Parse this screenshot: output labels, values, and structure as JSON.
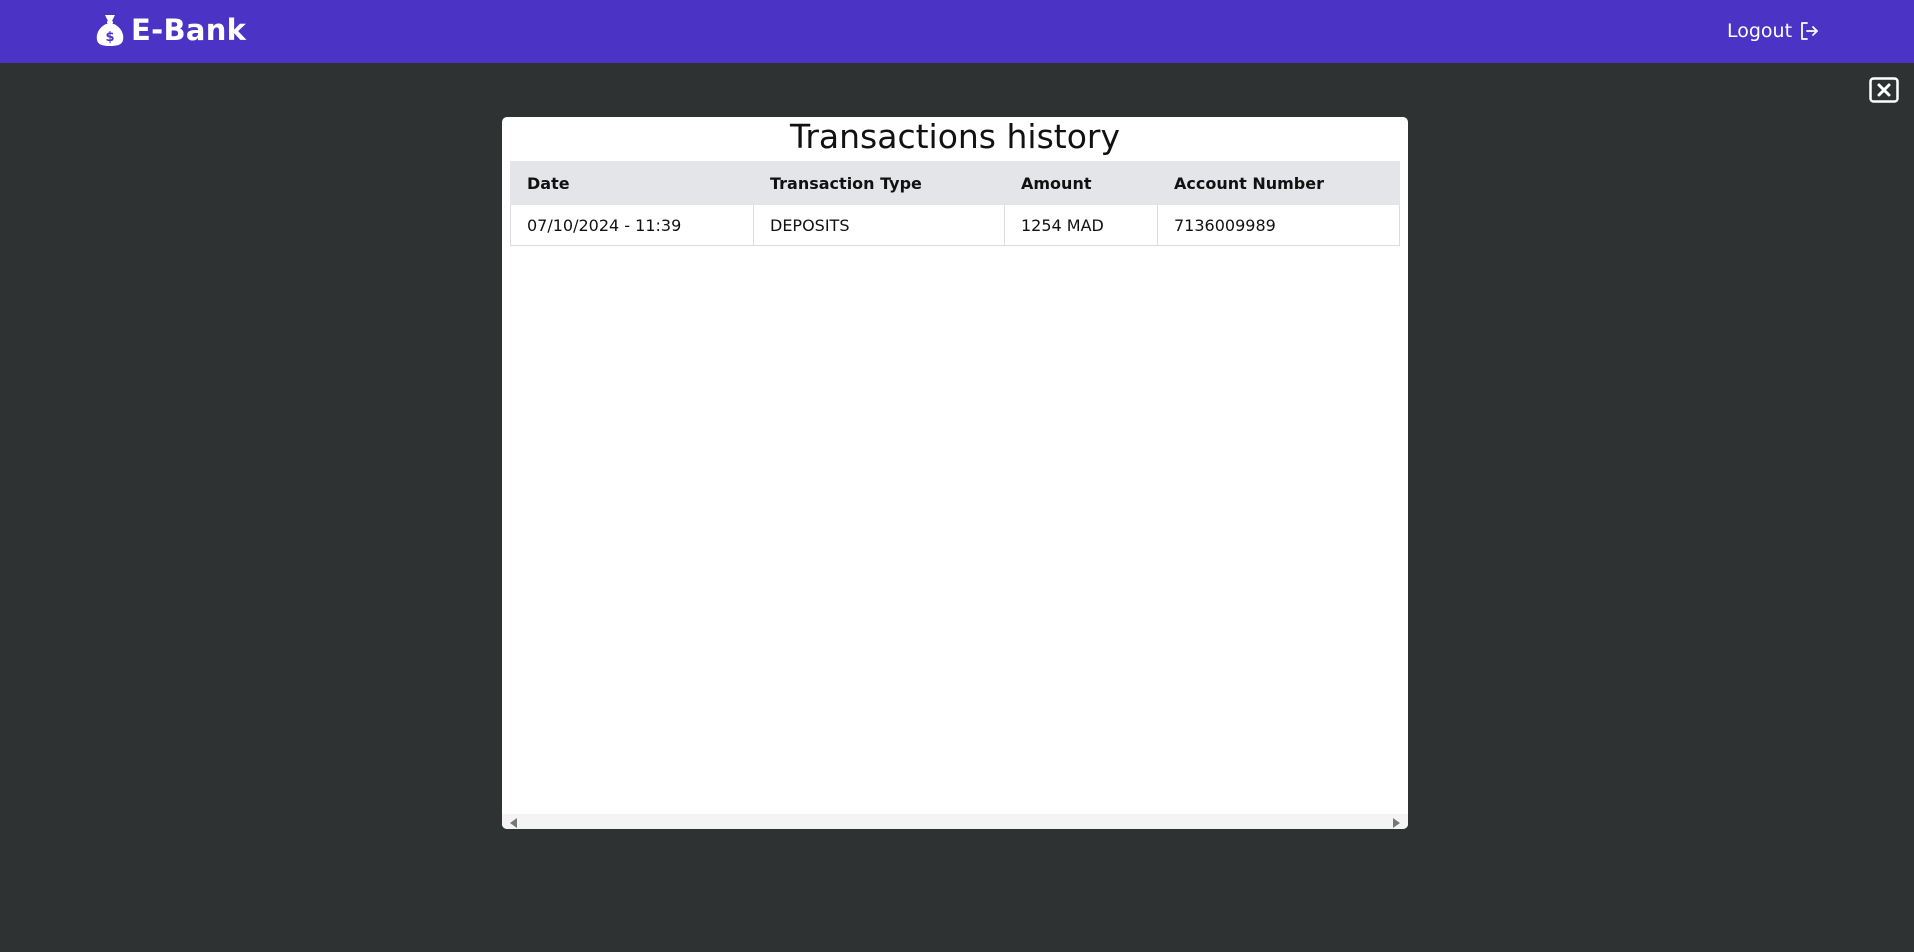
{
  "header": {
    "brand_name": "E-Bank",
    "brand_icon": "money-bag-icon",
    "logout_label": "Logout",
    "logout_icon": "logout-icon",
    "accent_color": "#4b33c6"
  },
  "overlay": {
    "close_icon": "close-icon",
    "background_color": "#2f3233"
  },
  "modal": {
    "title": "Transactions history",
    "table": {
      "columns": [
        "Date",
        "Transaction Type",
        "Amount",
        "Account Number"
      ],
      "rows": [
        [
          "07/10/2024 - 11:39",
          "DEPOSITS",
          "1254 MAD",
          "7136009989"
        ]
      ]
    }
  }
}
